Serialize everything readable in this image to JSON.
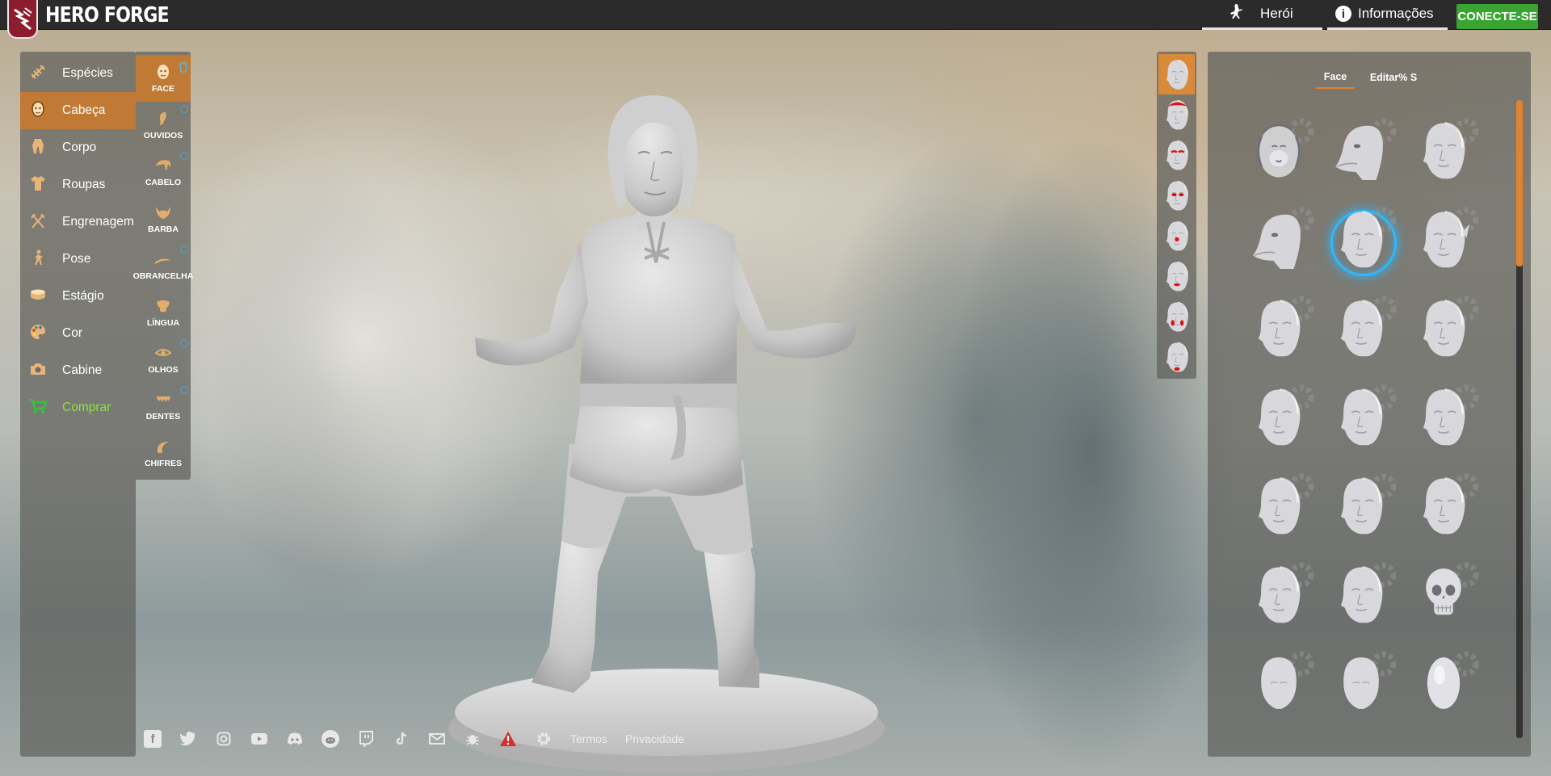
{
  "app": {
    "brand": "HERO FORGE"
  },
  "topbar": {
    "tabs": [
      {
        "label": "Herói",
        "icon": "hero-icon"
      },
      {
        "label": "Informações",
        "icon": "info-icon"
      }
    ],
    "connect_label": "CONECTE-SE"
  },
  "categories": [
    {
      "label": "Espécies",
      "icon": "dna-icon",
      "active": false
    },
    {
      "label": "Cabeça",
      "icon": "head-icon",
      "active": true
    },
    {
      "label": "Corpo",
      "icon": "body-icon",
      "active": false
    },
    {
      "label": "Roupas",
      "icon": "shirt-icon",
      "active": false
    },
    {
      "label": "Engrenagem",
      "icon": "axes-icon",
      "active": false
    },
    {
      "label": "Pose",
      "icon": "pose-icon",
      "active": false
    },
    {
      "label": "Estágio",
      "icon": "base-icon",
      "active": false
    },
    {
      "label": "Cor",
      "icon": "palette-icon",
      "active": false
    },
    {
      "label": "Cabine",
      "icon": "camera-icon",
      "active": false
    },
    {
      "label": "Comprar",
      "icon": "cart-icon",
      "active": false
    }
  ],
  "subcategories": [
    {
      "label": "FACE",
      "icon": "face-icon",
      "active": true
    },
    {
      "label": "OUVIDOS",
      "icon": "ear-icon",
      "active": false
    },
    {
      "label": "CABELO",
      "icon": "hair-icon",
      "active": false
    },
    {
      "label": "BARBA",
      "icon": "beard-icon",
      "active": false
    },
    {
      "label": "OBRANCELHA",
      "icon": "eyebrow-icon",
      "active": false
    },
    {
      "label": "LÍNGUA",
      "icon": "tongue-icon",
      "active": false
    },
    {
      "label": "OLHOS",
      "icon": "eye-icon",
      "active": false
    },
    {
      "label": "DENTES",
      "icon": "teeth-icon",
      "active": false
    },
    {
      "label": "CHIFRES",
      "icon": "horns-icon",
      "active": false
    }
  ],
  "face_panel": {
    "tabs": [
      "Face",
      "Editar% S"
    ],
    "active_tab": "Face",
    "selected_index": 4,
    "faces": [
      "lion-head",
      "beast-head",
      "alien-head",
      "lizard-head",
      "human-head",
      "elf-head",
      "human-head",
      "human-head",
      "human-head",
      "human-head",
      "human-head",
      "human-head",
      "human-head",
      "human-head",
      "human-head",
      "human-head",
      "human-head",
      "skull-head",
      "blank-head",
      "blank-head",
      "egg-head"
    ]
  },
  "presets": [
    "plain",
    "red-cap",
    "red-brows",
    "red-eyes",
    "red-nose",
    "red-lips",
    "red-cheeks",
    "red-chin"
  ],
  "footer": {
    "icons": [
      "facebook-icon",
      "twitter-icon",
      "instagram-icon",
      "youtube-icon",
      "discord-icon",
      "reddit-icon",
      "twitch-icon",
      "tiktok-icon",
      "mail-icon",
      "bug-icon",
      "warning-icon",
      "settings-icon"
    ],
    "links": [
      "Termos",
      "Privacidade"
    ]
  },
  "colors": {
    "accent": "#c07a36",
    "connect": "#39a432",
    "buy": "#8fe33b",
    "selection": "#2eb8ff"
  }
}
